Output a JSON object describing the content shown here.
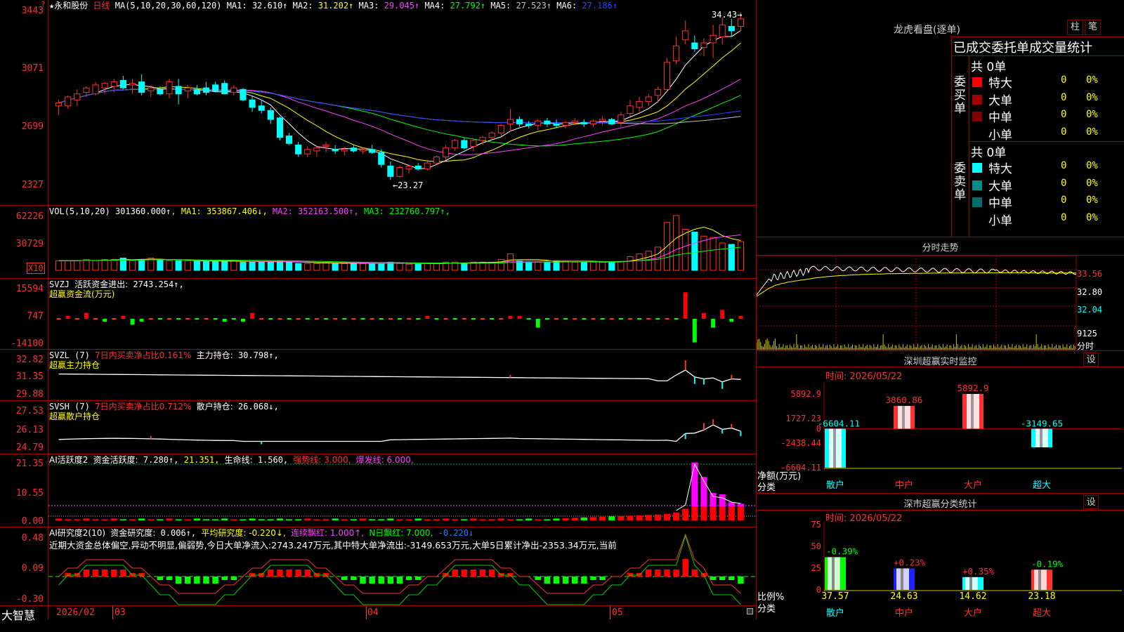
{
  "stock": {
    "name_prefix": "★",
    "name": "永和股份",
    "period": "日线",
    "ma_params": "MA(5,10,20,30,60,120)",
    "ma": [
      {
        "label": "MA1:",
        "value": "32.610↑",
        "color": "#ffffff"
      },
      {
        "label": "MA2:",
        "value": "31.202↑",
        "color": "#ffff00"
      },
      {
        "label": "MA3:",
        "value": "29.045↑",
        "color": "#ff40ff"
      },
      {
        "label": "MA4:",
        "value": "27.792↑",
        "color": "#00ff00"
      },
      {
        "label": "MA5:",
        "value": "27.523↑",
        "color": "#c0c0c0"
      },
      {
        "label": "MA6:",
        "value": "27.186↑",
        "color": "#3040ff"
      }
    ],
    "price_axis": [
      "3443",
      "3071",
      "2699",
      "2327"
    ],
    "max_label": "34.43",
    "min_label": "23.27",
    "price_axis_marker": "?"
  },
  "vol": {
    "header": "VOL(5,10,20)",
    "value": "301360.000↑",
    "ma": [
      {
        "label": "MA1:",
        "value": "353867.406↓",
        "color": "#ffff00"
      },
      {
        "label": "MA2:",
        "value": "352163.500↑",
        "color": "#ff40ff"
      },
      {
        "label": "MA3:",
        "value": "232760.797↑",
        "color": "#00ff00"
      }
    ],
    "axis": [
      "62226",
      "30729"
    ],
    "unit": "X10"
  },
  "svzj": {
    "header": "SVZJ",
    "label": "活跃资金进出:",
    "value": "2743.254↑",
    "subtitle": "超赢资金流(万元)",
    "axis": [
      "15594",
      "747",
      "-14100"
    ]
  },
  "svzl": {
    "header": "SVZL (7)",
    "label": "7日内买卖净占比0.161%",
    "label2": "主力持仓:",
    "value": "30.798↑,",
    "subtitle": "超赢主力持仓",
    "axis": [
      "32.82",
      "31.35",
      "29.88"
    ]
  },
  "svsh": {
    "header": "SVSH (7)",
    "label": "7日内买卖净占比0.712%",
    "label2": "散户持仓:",
    "value": "26.068↓,",
    "subtitle": "超赢散户持仓",
    "axis": [
      "27.53",
      "26.13",
      "24.79"
    ]
  },
  "ai1": {
    "header": "AI活跃度2",
    "label": "资金活跃度:",
    "value": "7.280↑,",
    "v2": "21.351,",
    "label3": "生命线:",
    "v3": "1.560,",
    "v4": "强势线: 3.000,",
    "v5": "爆发线: 6.000,",
    "axis": [
      "21.35",
      "10.55",
      "0.00"
    ]
  },
  "ai2": {
    "header": "AI研究度2(10)",
    "label": "资金研究度:",
    "value": "0.006↑,",
    "v2": "平均研究度: -0.220↓,",
    "v3": "连续飘红: 1.000↑,",
    "v4": "N日飘红: 7.000,",
    "v5": "-0.220↓",
    "comment": "近期大资金总体偏空,异动不明显,偏弱势,今日大单净流入:2743.247万元,其中特大单净流出:-3149.653万元,大单5日累计净出-2353.34万元,当前",
    "axis": [
      "0.48",
      "0.09",
      "-0.30"
    ]
  },
  "bottom_axis": {
    "logo": "大智慧",
    "dates": [
      "2026/02",
      "03",
      "04",
      "05"
    ]
  },
  "dragon": {
    "title": "龙虎看盘(逐单)",
    "btn1": "柱",
    "btn2": "笔",
    "header": "已成交委托单成交量统计",
    "buy": {
      "side": "委买单",
      "total": "共 0单",
      "rows": [
        {
          "name": "特大",
          "count": "0",
          "pct": "0%",
          "color": "#ff0000"
        },
        {
          "name": "大单",
          "count": "0",
          "pct": "0%",
          "color": "#a00000"
        },
        {
          "name": "中单",
          "count": "0",
          "pct": "0%",
          "color": "#800000"
        },
        {
          "name": "小单",
          "count": "0",
          "pct": "0%",
          "color": "#000000"
        }
      ]
    },
    "sell": {
      "side": "委卖单",
      "total": "共 0单",
      "rows": [
        {
          "name": "特大",
          "count": "0",
          "pct": "0%",
          "color": "#00ffff"
        },
        {
          "name": "大单",
          "count": "0",
          "pct": "0%",
          "color": "#008c8c"
        },
        {
          "name": "中单",
          "count": "0",
          "pct": "0%",
          "color": "#006c6c"
        },
        {
          "name": "小单",
          "count": "0",
          "pct": "0%",
          "color": "#000000"
        }
      ]
    }
  },
  "intraday": {
    "title": "分时走势",
    "axis": [
      "33.56",
      "32.80",
      "32.04"
    ],
    "vol_axis": "9125",
    "vol_label": "分时"
  },
  "monitor": {
    "title": "深圳超赢实时监控",
    "btn": "设",
    "time": "时间: 2026/05/22",
    "axis": [
      "5892.9",
      "1727.23",
      "0",
      "-2438.44",
      "-6604.11"
    ],
    "ylabel": "净额(万元)",
    "xlabel": "分类",
    "bars": [
      {
        "name": "散户",
        "value": -6604.11,
        "label": "-6604.11",
        "color": "#00ffff"
      },
      {
        "name": "中户",
        "value": 3860.86,
        "label": "3860.86",
        "color": "#ff3030"
      },
      {
        "name": "大户",
        "value": 5892.9,
        "label": "5892.9",
        "color": "#ff3030"
      },
      {
        "name": "超大",
        "value": -3149.65,
        "label": "-3149.65",
        "color": "#00ffff"
      }
    ]
  },
  "classify": {
    "title": "深市超赢分类统计",
    "btn": "设",
    "time": "时间: 2026/05/22",
    "axis": [
      "75",
      "50",
      "25",
      "0"
    ],
    "ylabel": "比例%",
    "xlabel": "分类",
    "bars": [
      {
        "name": "散户",
        "value": 37.57,
        "change": "-0.39%",
        "color": "#00ff00",
        "change_color": "#00ff00"
      },
      {
        "name": "中户",
        "value": 24.63,
        "change": "+0.23%",
        "color": "#2020ff",
        "change_color": "#ff3030"
      },
      {
        "name": "大户",
        "value": 14.62,
        "change": "+0.35%",
        "color": "#00ffff",
        "change_color": "#ff3030"
      },
      {
        "name": "超大",
        "value": 23.18,
        "change": "-0.19%",
        "color": "#ff3030",
        "change_color": "#00ff00"
      }
    ]
  },
  "chart_data": {
    "type": "candlestick",
    "dates_axis": [
      "2026/02",
      "03",
      "04",
      "05"
    ],
    "ylim": [
      23.27,
      34.43
    ],
    "max": 34.43,
    "min": 23.27,
    "candles": [
      [
        28.2,
        28.6,
        27.6,
        28.4
      ],
      [
        28.2,
        28.9,
        28.0,
        28.8
      ],
      [
        28.6,
        29.3,
        28.2,
        29.0
      ],
      [
        29.1,
        29.5,
        28.8,
        29.4
      ],
      [
        29.0,
        29.8,
        28.9,
        29.6
      ],
      [
        29.4,
        29.8,
        29.0,
        29.7
      ],
      [
        29.5,
        30.0,
        29.1,
        29.8
      ],
      [
        29.9,
        30.2,
        29.3,
        29.4
      ],
      [
        29.6,
        30.0,
        29.0,
        29.7
      ],
      [
        29.8,
        30.3,
        28.9,
        29.1
      ],
      [
        29.2,
        29.6,
        28.8,
        29.4
      ],
      [
        29.3,
        29.5,
        28.9,
        29.0
      ],
      [
        29.0,
        30.0,
        28.7,
        29.8
      ],
      [
        29.5,
        30.0,
        28.3,
        29.0
      ],
      [
        29.2,
        29.6,
        28.7,
        29.4
      ],
      [
        29.3,
        29.6,
        28.9,
        29.0
      ],
      [
        29.4,
        29.8,
        28.9,
        29.1
      ],
      [
        29.6,
        29.8,
        29.1,
        29.2
      ],
      [
        29.7,
        29.9,
        29.0,
        29.0
      ],
      [
        29.1,
        29.6,
        28.9,
        29.4
      ],
      [
        29.3,
        29.4,
        28.5,
        28.6
      ],
      [
        28.6,
        28.9,
        27.8,
        28.1
      ],
      [
        28.2,
        28.6,
        27.7,
        27.9
      ],
      [
        27.9,
        28.1,
        27.0,
        27.3
      ],
      [
        27.4,
        27.5,
        25.9,
        26.1
      ],
      [
        26.2,
        26.4,
        25.6,
        25.7
      ],
      [
        25.6,
        25.8,
        24.8,
        25.0
      ],
      [
        25.0,
        25.5,
        24.8,
        25.3
      ],
      [
        25.2,
        25.5,
        24.8,
        25.4
      ],
      [
        25.5,
        25.8,
        25.1,
        25.6
      ],
      [
        25.3,
        25.6,
        25.0,
        25.2
      ],
      [
        25.2,
        25.5,
        24.9,
        25.3
      ],
      [
        25.4,
        25.6,
        25.1,
        25.2
      ],
      [
        25.2,
        25.4,
        25.0,
        25.3
      ],
      [
        25.3,
        25.6,
        25.0,
        25.1
      ],
      [
        25.1,
        25.3,
        24.1,
        24.3
      ],
      [
        24.2,
        24.5,
        23.27,
        23.5
      ],
      [
        23.5,
        24.2,
        23.4,
        24.1
      ],
      [
        24.0,
        24.3,
        23.7,
        24.2
      ],
      [
        24.2,
        24.4,
        23.9,
        24.0
      ],
      [
        24.0,
        24.5,
        23.9,
        24.4
      ],
      [
        24.4,
        24.9,
        24.3,
        24.8
      ],
      [
        24.8,
        25.6,
        24.6,
        25.4
      ],
      [
        25.4,
        26.0,
        25.2,
        25.9
      ],
      [
        25.9,
        26.1,
        25.3,
        25.4
      ],
      [
        25.5,
        26.0,
        25.2,
        25.9
      ],
      [
        25.9,
        26.2,
        25.6,
        26.1
      ],
      [
        26.1,
        26.5,
        25.9,
        26.4
      ],
      [
        26.4,
        27.0,
        26.2,
        26.9
      ],
      [
        27.0,
        28.0,
        26.5,
        27.3
      ],
      [
        27.3,
        27.5,
        26.8,
        27.0
      ],
      [
        27.0,
        27.2,
        26.7,
        26.9
      ],
      [
        26.9,
        27.3,
        26.6,
        27.2
      ],
      [
        27.2,
        27.4,
        26.8,
        27.0
      ],
      [
        27.0,
        27.3,
        26.7,
        26.9
      ],
      [
        26.9,
        27.2,
        26.7,
        27.1
      ],
      [
        27.1,
        27.4,
        26.9,
        27.2
      ],
      [
        27.1,
        27.3,
        26.8,
        27.0
      ],
      [
        27.0,
        27.3,
        26.8,
        27.2
      ],
      [
        27.2,
        27.5,
        26.9,
        27.3
      ],
      [
        27.3,
        27.4,
        26.9,
        27.0
      ],
      [
        27.1,
        27.8,
        26.8,
        27.6
      ],
      [
        27.7,
        28.6,
        27.5,
        28.2
      ],
      [
        28.1,
        28.8,
        27.8,
        28.5
      ],
      [
        28.5,
        29.0,
        28.2,
        28.8
      ],
      [
        28.9,
        29.5,
        28.4,
        29.3
      ],
      [
        29.3,
        31.4,
        29.1,
        31.1
      ],
      [
        31.2,
        32.8,
        31.0,
        32.2
      ],
      [
        32.6,
        33.9,
        32.3,
        33.2
      ],
      [
        32.4,
        32.9,
        31.8,
        32.0
      ],
      [
        32.1,
        32.7,
        31.5,
        32.4
      ],
      [
        32.4,
        33.6,
        31.4,
        32.9
      ],
      [
        32.8,
        34.1,
        32.3,
        33.6
      ],
      [
        33.5,
        34.0,
        32.8,
        33.2
      ],
      [
        33.5,
        34.43,
        33.2,
        34.0
      ]
    ]
  }
}
